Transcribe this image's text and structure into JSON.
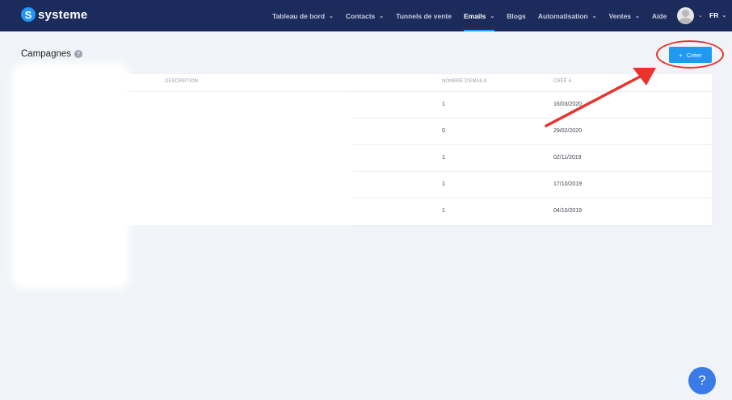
{
  "brand": {
    "name": "systeme",
    "mark": "S"
  },
  "nav": {
    "items": [
      {
        "label": "Tableau de bord",
        "dropdown": true,
        "active": false
      },
      {
        "label": "Contacts",
        "dropdown": true,
        "active": false
      },
      {
        "label": "Tunnels de vente",
        "dropdown": false,
        "active": false
      },
      {
        "label": "Emails",
        "dropdown": true,
        "active": true
      },
      {
        "label": "Blogs",
        "dropdown": false,
        "active": false
      },
      {
        "label": "Automatisation",
        "dropdown": true,
        "active": false
      },
      {
        "label": "Ventes",
        "dropdown": true,
        "active": false
      },
      {
        "label": "Aide",
        "dropdown": false,
        "active": false
      }
    ],
    "language": "FR"
  },
  "page": {
    "title": "Campagnes",
    "help_glyph": "?",
    "create_button": {
      "icon": "+",
      "label": "Créer"
    }
  },
  "table": {
    "columns": [
      "",
      "DESCRIPTION",
      "NOMBRE D'EMAILS",
      "CRÉÉ À"
    ],
    "rows": [
      {
        "name": "",
        "description": "",
        "emails": "1",
        "created": "16/03/2020"
      },
      {
        "name": "",
        "description": "",
        "emails": "0",
        "created": "29/02/2020"
      },
      {
        "name": "",
        "description": "",
        "emails": "1",
        "created": "02/11/2019"
      },
      {
        "name": "",
        "description": "",
        "emails": "1",
        "created": "17/10/2019"
      },
      {
        "name": "",
        "description": "",
        "emails": "1",
        "created": "04/10/2019"
      }
    ]
  },
  "help_fab": {
    "glyph": "?"
  },
  "colors": {
    "navbar": "#1b2b5b",
    "accent": "#1e9bf0",
    "annotation": "#e8342c",
    "page_bg": "#f1f3f8"
  }
}
